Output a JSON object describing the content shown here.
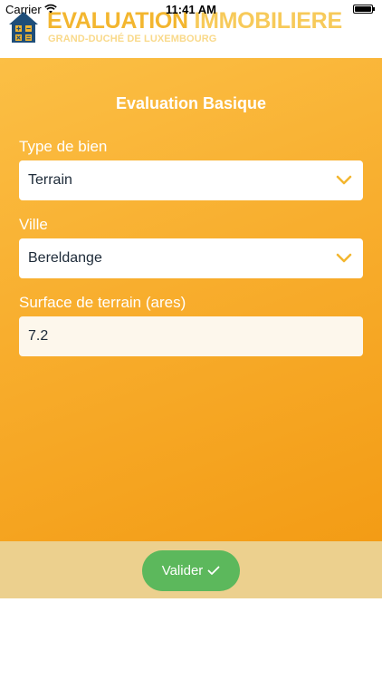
{
  "status_bar": {
    "carrier": "Carrier",
    "time": "11:41 AM"
  },
  "header": {
    "title_part1": "EVALUATION",
    "title_part2": "IMMOBILIERE",
    "subtitle": "GRAND-DUCHÉ DE LUXEMBOURG"
  },
  "form": {
    "title": "Evaluation Basique",
    "property_type": {
      "label": "Type de bien",
      "value": "Terrain"
    },
    "city": {
      "label": "Ville",
      "value": "Bereldange"
    },
    "land_area": {
      "label": "Surface de terrain (ares)",
      "value": "7.2"
    }
  },
  "footer": {
    "validate_label": "Valider"
  },
  "colors": {
    "accent": "#f8ae2e",
    "brand_blue": "#1f4e79",
    "button_green": "#5cb85c",
    "footer_bg": "#ecd08e"
  }
}
